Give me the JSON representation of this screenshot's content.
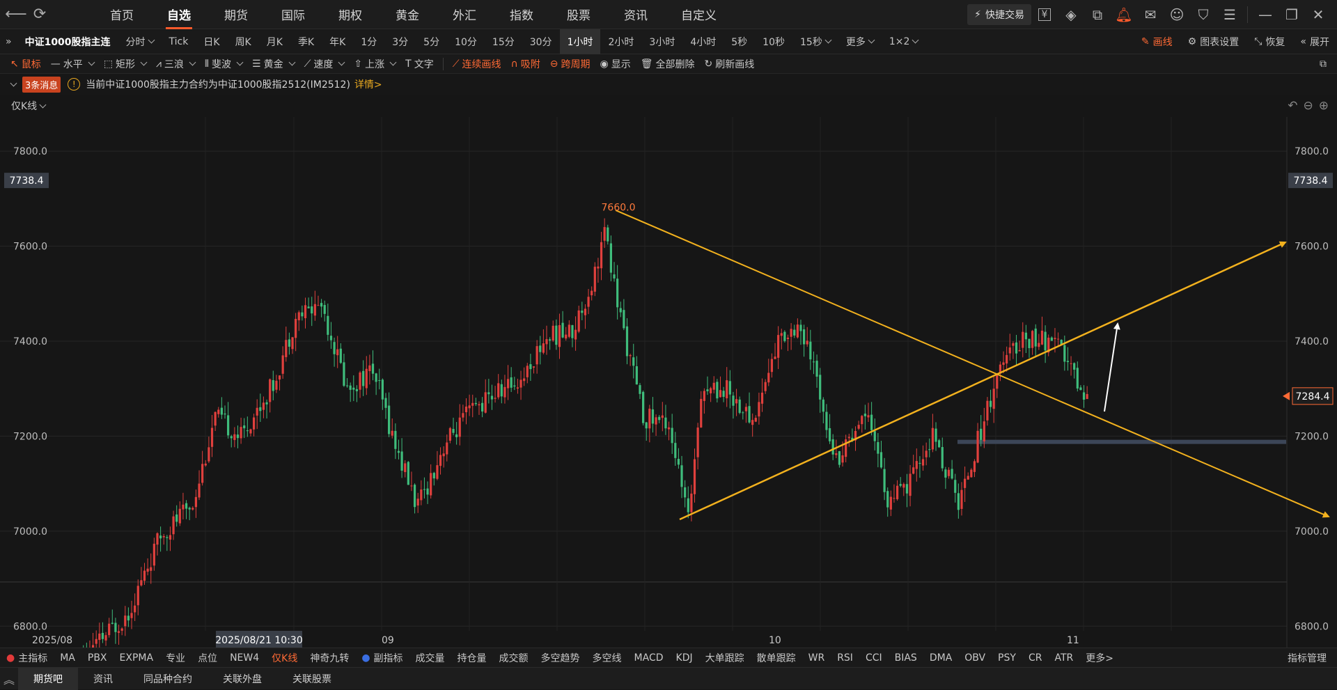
{
  "topnav": {
    "tabs": [
      "首页",
      "自选",
      "期货",
      "国际",
      "期权",
      "黄金",
      "外汇",
      "指数",
      "股票",
      "资讯",
      "自定义"
    ],
    "active_tab": 1,
    "quick_trade_label": "快捷交易",
    "icons": [
      "yuan-icon",
      "layers-icon",
      "popout-icon",
      "bell-icon",
      "mail-icon",
      "user-icon",
      "shirt-icon",
      "menu-icon",
      "minimize-icon",
      "restore-icon",
      "close-icon"
    ]
  },
  "periodbar": {
    "symbol": "中证1000股指主连",
    "periods": [
      "分时",
      "Tick",
      "日K",
      "周K",
      "月K",
      "季K",
      "年K",
      "1分",
      "3分",
      "5分",
      "10分",
      "15分",
      "30分",
      "1小时",
      "2小时",
      "3小时",
      "4小时",
      "5秒",
      "10秒",
      "15秒",
      "更多",
      "1×2"
    ],
    "active_period": "1小时",
    "draw_label": "画线",
    "settings_label": "图表设置",
    "restore_label": "恢复",
    "expand_label": "展开"
  },
  "drawbar": {
    "tools": [
      "鼠标",
      "水平",
      "矩形",
      "三浪",
      "斐波",
      "黄金",
      "速度",
      "上涨",
      "文字"
    ],
    "actions": [
      "连续画线",
      "吸附",
      "跨周期",
      "显示",
      "全部删除",
      "刷新画线"
    ]
  },
  "msgbar": {
    "badge": "3条消息",
    "message": "当前中证1000股指主力合约为中证1000股指2512(IM2512)",
    "detail_link": "详情>"
  },
  "ktype": {
    "label": "仅K线"
  },
  "chart_data": {
    "type": "candlestick",
    "y_ticks": [
      7800.0,
      7600.0,
      7400.0,
      7200.0,
      7000.0,
      6800.0
    ],
    "y_range": [
      6755,
      7872
    ],
    "x_labels": [
      "2025/08",
      "09",
      "10",
      "11"
    ],
    "cursor_date": "2025/08/21 10:30",
    "cursor_price": "7738.4",
    "last_price": "7284.4",
    "high_label": "7660.0",
    "reference_price": 7188,
    "count": 250,
    "seed": 11,
    "anchors": [
      [
        0,
        6700
      ],
      [
        10,
        6760
      ],
      [
        20,
        6830
      ],
      [
        30,
        6990
      ],
      [
        40,
        7060
      ],
      [
        47,
        7240
      ],
      [
        55,
        7200
      ],
      [
        65,
        7310
      ],
      [
        72,
        7450
      ],
      [
        80,
        7480
      ],
      [
        88,
        7300
      ],
      [
        96,
        7340
      ],
      [
        103,
        7180
      ],
      [
        110,
        7050
      ],
      [
        118,
        7180
      ],
      [
        126,
        7250
      ],
      [
        134,
        7290
      ],
      [
        142,
        7320
      ],
      [
        150,
        7410
      ],
      [
        158,
        7420
      ],
      [
        164,
        7520
      ],
      [
        168,
        7630
      ],
      [
        172,
        7480
      ],
      [
        180,
        7240
      ],
      [
        188,
        7230
      ],
      [
        194,
        7020
      ],
      [
        198,
        7300
      ],
      [
        206,
        7300
      ],
      [
        214,
        7230
      ],
      [
        222,
        7400
      ],
      [
        228,
        7440
      ],
      [
        234,
        7320
      ],
      [
        240,
        7150
      ],
      [
        246,
        7220
      ],
      [
        250,
        7260
      ],
      [
        256,
        7060
      ],
      [
        262,
        7090
      ],
      [
        270,
        7200
      ],
      [
        278,
        7060
      ],
      [
        284,
        7190
      ],
      [
        290,
        7330
      ],
      [
        298,
        7410
      ],
      [
        304,
        7400
      ],
      [
        310,
        7380
      ],
      [
        316,
        7300
      ],
      [
        318,
        7284
      ]
    ]
  }
}
